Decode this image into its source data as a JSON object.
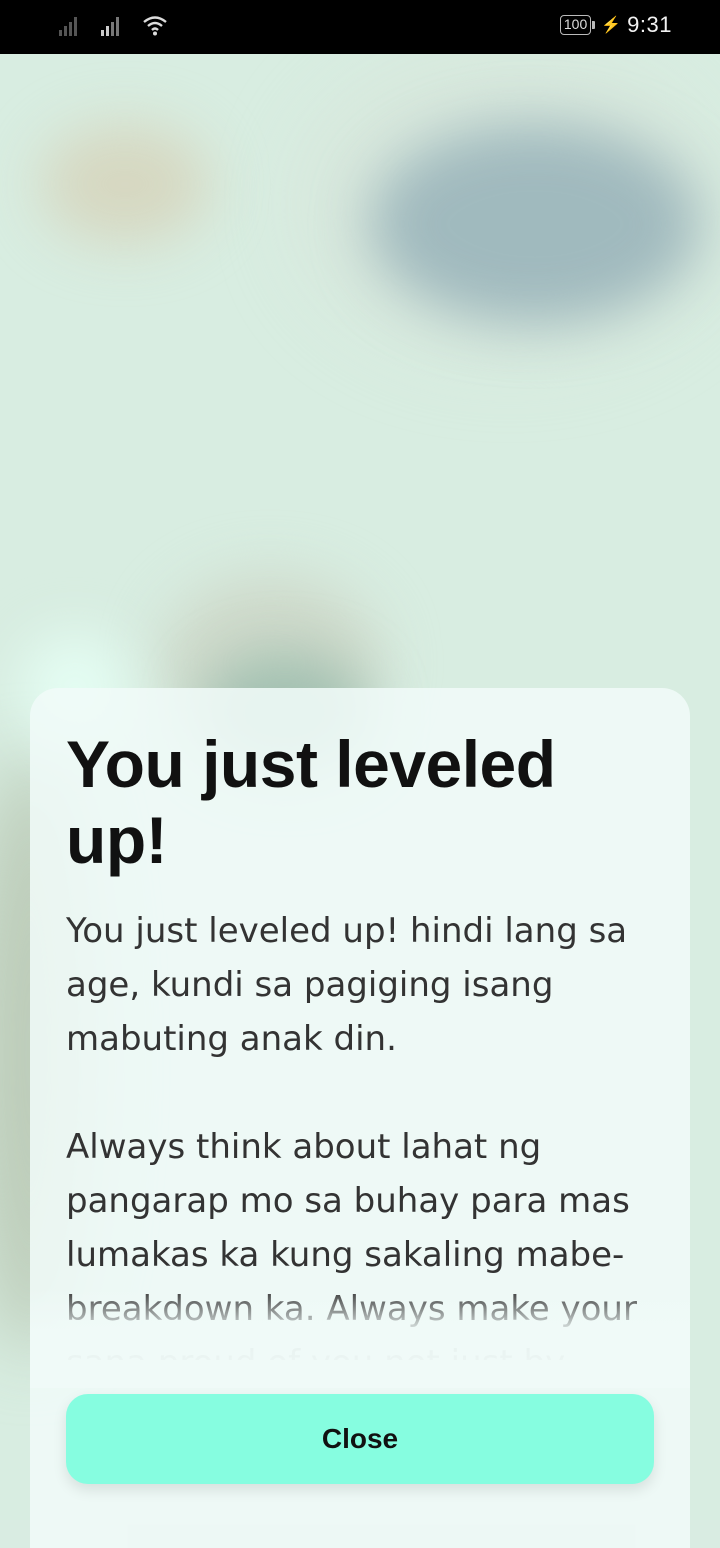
{
  "status_bar": {
    "battery": "100",
    "time": "9:31",
    "icons": [
      "signal-icon",
      "signal-icon",
      "wifi-icon",
      "battery-icon",
      "charging-icon"
    ]
  },
  "dialog": {
    "title": "You just leveled up!",
    "paragraphs": [
      "You just leveled up! hindi lang sa age, kundi sa pagiging isang mabuting anak din.",
      "Always think about lahat ng pangarap mo sa buhay para mas lumakas ka kung sakaling mabe-breakdown ka. Always make your sana proud of you not just by"
    ],
    "close_label": "Close"
  },
  "colors": {
    "accent": "#86fde0",
    "status_bar": "#000000",
    "background": "#d8ede1"
  }
}
